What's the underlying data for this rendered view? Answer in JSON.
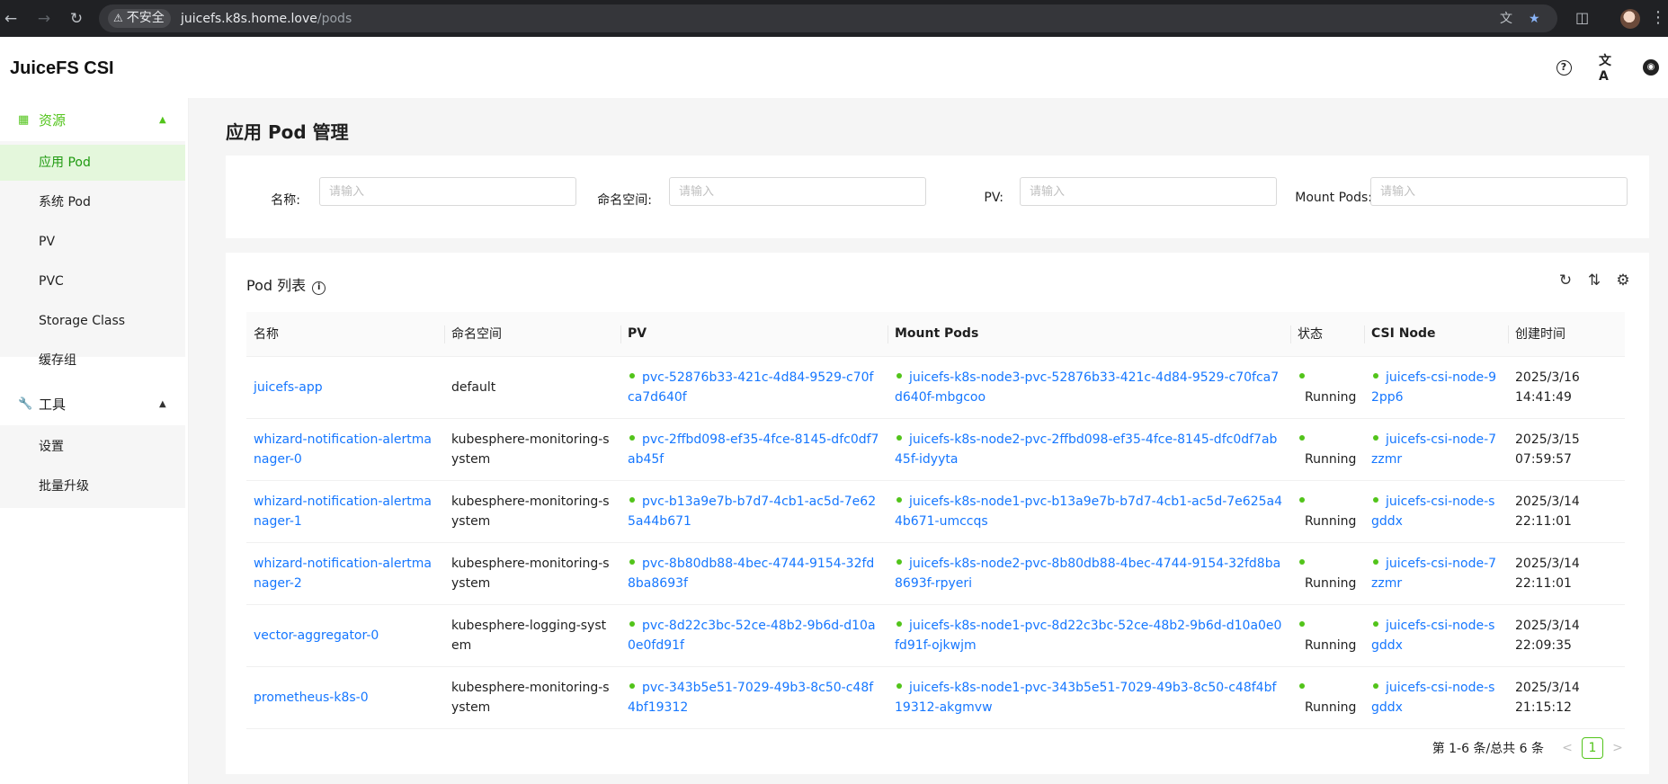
{
  "browser": {
    "security_label": "不安全",
    "url_host": "juicefs.k8s.home.love",
    "url_path": "/pods"
  },
  "app": {
    "title": "JuiceFS CSI"
  },
  "sidebar": {
    "groups": [
      {
        "label": "资源",
        "items": [
          "应用 Pod",
          "系统 Pod",
          "PV",
          "PVC",
          "Storage Class",
          "缓存组"
        ]
      },
      {
        "label": "工具",
        "items": [
          "设置",
          "批量升级"
        ]
      }
    ],
    "selected": "应用 Pod"
  },
  "page": {
    "title_prefix": "应用 ",
    "title_bold": "Pod",
    "title_suffix": " 管理"
  },
  "filters": [
    {
      "label": "名称",
      "placeholder": "请输入",
      "value": ""
    },
    {
      "label": "命名空间",
      "placeholder": "请输入",
      "value": ""
    },
    {
      "label": "PV",
      "placeholder": "请输入",
      "value": ""
    },
    {
      "label": "Mount Pods",
      "placeholder": "请输入",
      "value": ""
    }
  ],
  "list": {
    "title": "Pod 列表",
    "columns": [
      "名称",
      "命名空间",
      "PV",
      "Mount Pods",
      "状态",
      "CSI Node",
      "创建时间"
    ],
    "rows": [
      {
        "name": "juicefs-app",
        "namespace": "default",
        "pv": "pvc-52876b33-421c-4d84-9529-c70fca7d640f",
        "mount_pod": "juicefs-k8s-node3-pvc-52876b33-421c-4d84-9529-c70fca7d640f-mbgcoo",
        "status": "Running",
        "csi_node": "juicefs-csi-node-92pp6",
        "created_date": "2025/3/16",
        "created_time": "14:41:49"
      },
      {
        "name": "whizard-notification-alertmanager-0",
        "namespace": "kubesphere-monitoring-system",
        "pv": "pvc-2ffbd098-ef35-4fce-8145-dfc0df7ab45f",
        "mount_pod": "juicefs-k8s-node2-pvc-2ffbd098-ef35-4fce-8145-dfc0df7ab45f-idyyta",
        "status": "Running",
        "csi_node": "juicefs-csi-node-7zzmr",
        "created_date": "2025/3/15",
        "created_time": "07:59:57"
      },
      {
        "name": "whizard-notification-alertmanager-1",
        "namespace": "kubesphere-monitoring-system",
        "pv": "pvc-b13a9e7b-b7d7-4cb1-ac5d-7e625a44b671",
        "mount_pod": "juicefs-k8s-node1-pvc-b13a9e7b-b7d7-4cb1-ac5d-7e625a44b671-umccqs",
        "status": "Running",
        "csi_node": "juicefs-csi-node-sgddx",
        "created_date": "2025/3/14",
        "created_time": "22:11:01"
      },
      {
        "name": "whizard-notification-alertmanager-2",
        "namespace": "kubesphere-monitoring-system",
        "pv": "pvc-8b80db88-4bec-4744-9154-32fd8ba8693f",
        "mount_pod": "juicefs-k8s-node2-pvc-8b80db88-4bec-4744-9154-32fd8ba8693f-rpyeri",
        "status": "Running",
        "csi_node": "juicefs-csi-node-7zzmr",
        "created_date": "2025/3/14",
        "created_time": "22:11:01"
      },
      {
        "name": "vector-aggregator-0",
        "namespace": "kubesphere-logging-system",
        "pv": "pvc-8d22c3bc-52ce-48b2-9b6d-d10a0e0fd91f",
        "mount_pod": "juicefs-k8s-node1-pvc-8d22c3bc-52ce-48b2-9b6d-d10a0e0fd91f-ojkwjm",
        "status": "Running",
        "csi_node": "juicefs-csi-node-sgddx",
        "created_date": "2025/3/14",
        "created_time": "22:09:35"
      },
      {
        "name": "prometheus-k8s-0",
        "namespace": "kubesphere-monitoring-system",
        "pv": "pvc-343b5e51-7029-49b3-8c50-c48f4bf19312",
        "mount_pod": "juicefs-k8s-node1-pvc-343b5e51-7029-49b3-8c50-c48f4bf19312-akgmvw",
        "status": "Running",
        "csi_node": "juicefs-csi-node-sgddx",
        "created_date": "2025/3/14",
        "created_time": "21:15:12"
      }
    ]
  },
  "pagination": {
    "summary": "第 1-6 条/总共 6 条",
    "current_page": "1",
    "prev": "<",
    "next": ">"
  },
  "colors": {
    "accent": "#52c41a",
    "link": "#1677ff",
    "selected_bg": "#e4f7dc"
  },
  "icons": {
    "back": "arrow-left-icon",
    "forward": "arrow-right-icon",
    "reload": "reload-icon",
    "warning": "warning-icon",
    "translate": "translate-icon",
    "bookmark": "star-icon",
    "extensions": "puzzle-icon",
    "help": "help-icon",
    "language": "language-icon",
    "github": "github-icon",
    "resources": "database-icon",
    "tools": "wrench-icon",
    "refresh": "refresh-icon",
    "density": "column-height-icon",
    "settings": "setting-icon",
    "info": "info-icon"
  }
}
